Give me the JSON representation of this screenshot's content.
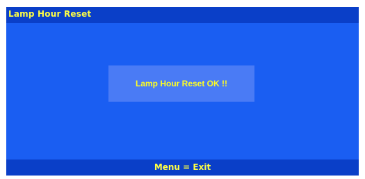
{
  "window": {
    "title": "Lamp Hour Reset"
  },
  "message": {
    "text": "Lamp Hour Reset OK !!"
  },
  "footer": {
    "hint": "Menu = Exit"
  },
  "colors": {
    "panel_bg": "#1a5ef2",
    "bar_bg": "#0a3fc8",
    "message_bg": "#4a7bf5",
    "text": "#ffff44"
  }
}
